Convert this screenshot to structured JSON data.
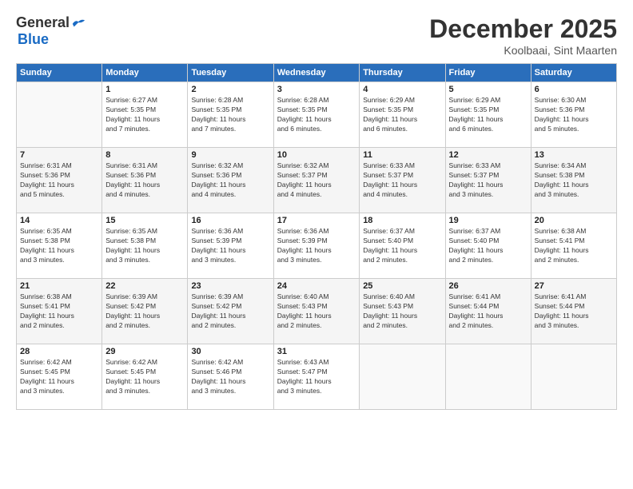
{
  "logo": {
    "general": "General",
    "blue": "Blue"
  },
  "title": {
    "month": "December 2025",
    "location": "Koolbaai, Sint Maarten"
  },
  "weekdays": [
    "Sunday",
    "Monday",
    "Tuesday",
    "Wednesday",
    "Thursday",
    "Friday",
    "Saturday"
  ],
  "weeks": [
    [
      {
        "day": "",
        "info": ""
      },
      {
        "day": "1",
        "info": "Sunrise: 6:27 AM\nSunset: 5:35 PM\nDaylight: 11 hours\nand 7 minutes."
      },
      {
        "day": "2",
        "info": "Sunrise: 6:28 AM\nSunset: 5:35 PM\nDaylight: 11 hours\nand 7 minutes."
      },
      {
        "day": "3",
        "info": "Sunrise: 6:28 AM\nSunset: 5:35 PM\nDaylight: 11 hours\nand 6 minutes."
      },
      {
        "day": "4",
        "info": "Sunrise: 6:29 AM\nSunset: 5:35 PM\nDaylight: 11 hours\nand 6 minutes."
      },
      {
        "day": "5",
        "info": "Sunrise: 6:29 AM\nSunset: 5:35 PM\nDaylight: 11 hours\nand 6 minutes."
      },
      {
        "day": "6",
        "info": "Sunrise: 6:30 AM\nSunset: 5:36 PM\nDaylight: 11 hours\nand 5 minutes."
      }
    ],
    [
      {
        "day": "7",
        "info": "Sunrise: 6:31 AM\nSunset: 5:36 PM\nDaylight: 11 hours\nand 5 minutes."
      },
      {
        "day": "8",
        "info": "Sunrise: 6:31 AM\nSunset: 5:36 PM\nDaylight: 11 hours\nand 4 minutes."
      },
      {
        "day": "9",
        "info": "Sunrise: 6:32 AM\nSunset: 5:36 PM\nDaylight: 11 hours\nand 4 minutes."
      },
      {
        "day": "10",
        "info": "Sunrise: 6:32 AM\nSunset: 5:37 PM\nDaylight: 11 hours\nand 4 minutes."
      },
      {
        "day": "11",
        "info": "Sunrise: 6:33 AM\nSunset: 5:37 PM\nDaylight: 11 hours\nand 4 minutes."
      },
      {
        "day": "12",
        "info": "Sunrise: 6:33 AM\nSunset: 5:37 PM\nDaylight: 11 hours\nand 3 minutes."
      },
      {
        "day": "13",
        "info": "Sunrise: 6:34 AM\nSunset: 5:38 PM\nDaylight: 11 hours\nand 3 minutes."
      }
    ],
    [
      {
        "day": "14",
        "info": "Sunrise: 6:35 AM\nSunset: 5:38 PM\nDaylight: 11 hours\nand 3 minutes."
      },
      {
        "day": "15",
        "info": "Sunrise: 6:35 AM\nSunset: 5:38 PM\nDaylight: 11 hours\nand 3 minutes."
      },
      {
        "day": "16",
        "info": "Sunrise: 6:36 AM\nSunset: 5:39 PM\nDaylight: 11 hours\nand 3 minutes."
      },
      {
        "day": "17",
        "info": "Sunrise: 6:36 AM\nSunset: 5:39 PM\nDaylight: 11 hours\nand 3 minutes."
      },
      {
        "day": "18",
        "info": "Sunrise: 6:37 AM\nSunset: 5:40 PM\nDaylight: 11 hours\nand 2 minutes."
      },
      {
        "day": "19",
        "info": "Sunrise: 6:37 AM\nSunset: 5:40 PM\nDaylight: 11 hours\nand 2 minutes."
      },
      {
        "day": "20",
        "info": "Sunrise: 6:38 AM\nSunset: 5:41 PM\nDaylight: 11 hours\nand 2 minutes."
      }
    ],
    [
      {
        "day": "21",
        "info": "Sunrise: 6:38 AM\nSunset: 5:41 PM\nDaylight: 11 hours\nand 2 minutes."
      },
      {
        "day": "22",
        "info": "Sunrise: 6:39 AM\nSunset: 5:42 PM\nDaylight: 11 hours\nand 2 minutes."
      },
      {
        "day": "23",
        "info": "Sunrise: 6:39 AM\nSunset: 5:42 PM\nDaylight: 11 hours\nand 2 minutes."
      },
      {
        "day": "24",
        "info": "Sunrise: 6:40 AM\nSunset: 5:43 PM\nDaylight: 11 hours\nand 2 minutes."
      },
      {
        "day": "25",
        "info": "Sunrise: 6:40 AM\nSunset: 5:43 PM\nDaylight: 11 hours\nand 2 minutes."
      },
      {
        "day": "26",
        "info": "Sunrise: 6:41 AM\nSunset: 5:44 PM\nDaylight: 11 hours\nand 2 minutes."
      },
      {
        "day": "27",
        "info": "Sunrise: 6:41 AM\nSunset: 5:44 PM\nDaylight: 11 hours\nand 3 minutes."
      }
    ],
    [
      {
        "day": "28",
        "info": "Sunrise: 6:42 AM\nSunset: 5:45 PM\nDaylight: 11 hours\nand 3 minutes."
      },
      {
        "day": "29",
        "info": "Sunrise: 6:42 AM\nSunset: 5:45 PM\nDaylight: 11 hours\nand 3 minutes."
      },
      {
        "day": "30",
        "info": "Sunrise: 6:42 AM\nSunset: 5:46 PM\nDaylight: 11 hours\nand 3 minutes."
      },
      {
        "day": "31",
        "info": "Sunrise: 6:43 AM\nSunset: 5:47 PM\nDaylight: 11 hours\nand 3 minutes."
      },
      {
        "day": "",
        "info": ""
      },
      {
        "day": "",
        "info": ""
      },
      {
        "day": "",
        "info": ""
      }
    ]
  ]
}
